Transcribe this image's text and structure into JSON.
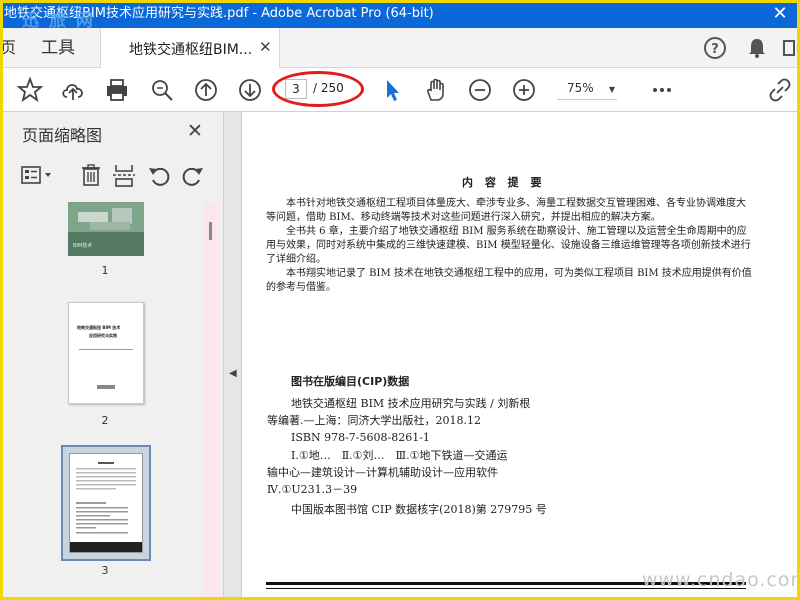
{
  "window": {
    "title": "地铁交通枢纽BIM技术应用研究与实践.pdf - Adobe Acrobat Pro (64-bit)",
    "watermark_top": "迅 旅 网"
  },
  "tabs": {
    "home_cut": "页",
    "tools": "工具",
    "document": "地铁交通枢纽BIM..."
  },
  "toolbar": {
    "current_page": "3",
    "total_pages": "/ 250",
    "zoom": "75%",
    "highlight_color": "#e21b1b"
  },
  "sidebar": {
    "title": "页面缩略图",
    "thumbnails": [
      {
        "num": "1",
        "cover_caption": "BIM技术"
      },
      {
        "num": "2",
        "title_line1": "地铁交通枢纽 BIM 技术",
        "title_line2": "应用研究与实践"
      },
      {
        "num": "3",
        "selected": true
      }
    ]
  },
  "document": {
    "summary_title": "内 容 提 要",
    "summary_paragraphs": [
      "本书针对地铁交通枢纽工程项目体量庞大、牵涉专业多、海量工程数据交互管理困难、各专业协调难度大等问题，借助 BIM、移动终端等技术对这些问题进行深入研究，并提出相应的解决方案。",
      "全书共 6 章，主要介绍了地铁交通枢纽 BIM 服务系统在勘察设计、施工管理以及运营全生命周期中的应用与效果，同时对系统中集成的三维快速建模、BIM 模型轻量化、设施设备三维运维管理等各项创新技术进行了详细介绍。",
      "本书翔实地记录了 BIM 技术在地铁交通枢纽工程中的应用，可为类似工程项目 BIM 技术应用提供有价值的参考与借鉴。"
    ],
    "cip_title": "图书在版编目(CIP)数据",
    "cip_lines": [
      "地铁交通枢纽 BIM 技术应用研究与实践 / 刘新根",
      "等编著.—上海：同济大学出版社，2018.12",
      "ISBN 978-7-5608-8261-1",
      "Ⅰ.①地…　Ⅱ.①刘…　Ⅲ.①地下铁道—交通运",
      "输中心—建筑设计—计算机辅助设计—应用软件",
      "Ⅳ.①U231.3－39",
      "中国版本图书馆 CIP 数据核字(2018)第 279795 号"
    ],
    "watermark": "www.cndao.com"
  }
}
